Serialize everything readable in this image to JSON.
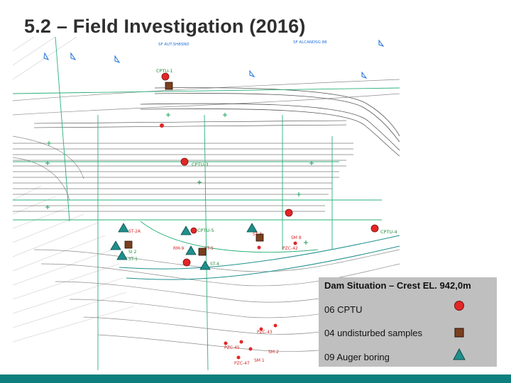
{
  "slide": {
    "title": "5.2 – Field Investigation (2016)"
  },
  "legend": {
    "title": "Dam Situation – Crest EL. 942,0m",
    "items": [
      {
        "label": "06 CPTU",
        "symbol": "red-circle-icon",
        "color": "#e32626"
      },
      {
        "label": "04 undisturbed samples",
        "symbol": "brown-square-icon",
        "color": "#7a3f1e"
      },
      {
        "label": "09 Auger boring",
        "symbol": "teal-triangle-icon",
        "color": "#1f8f8c"
      }
    ]
  },
  "drawing": {
    "top_labels": [
      "SF AUT.SH8SND",
      "SF ALCANDSG 88"
    ],
    "point_labels": {
      "cptu_1": "CPTU-1",
      "cptu_3": "CPTU-3",
      "cptu_4": "CPTU-4",
      "cptu_5": "CPTU-5",
      "st_2a": "ST-2A",
      "st_3": "ST-3",
      "st_5": "ST-5",
      "st_4": "ST-4",
      "si_2": "SI 2",
      "st_1": "ST-1",
      "sm_8": "SM 8",
      "pzc_42": "PZC-42",
      "rm_9": "RM-9",
      "sm_1": "SM 1",
      "sm_2": "SM-2",
      "pzc_43": "PZC-43",
      "pzc_45": "PZC-45",
      "pzc_47": "PZC-47"
    }
  },
  "colors": {
    "cptu": "#e32626",
    "sample": "#7a3f1e",
    "auger": "#1f8f8c",
    "footer": "#0d7f7f"
  }
}
